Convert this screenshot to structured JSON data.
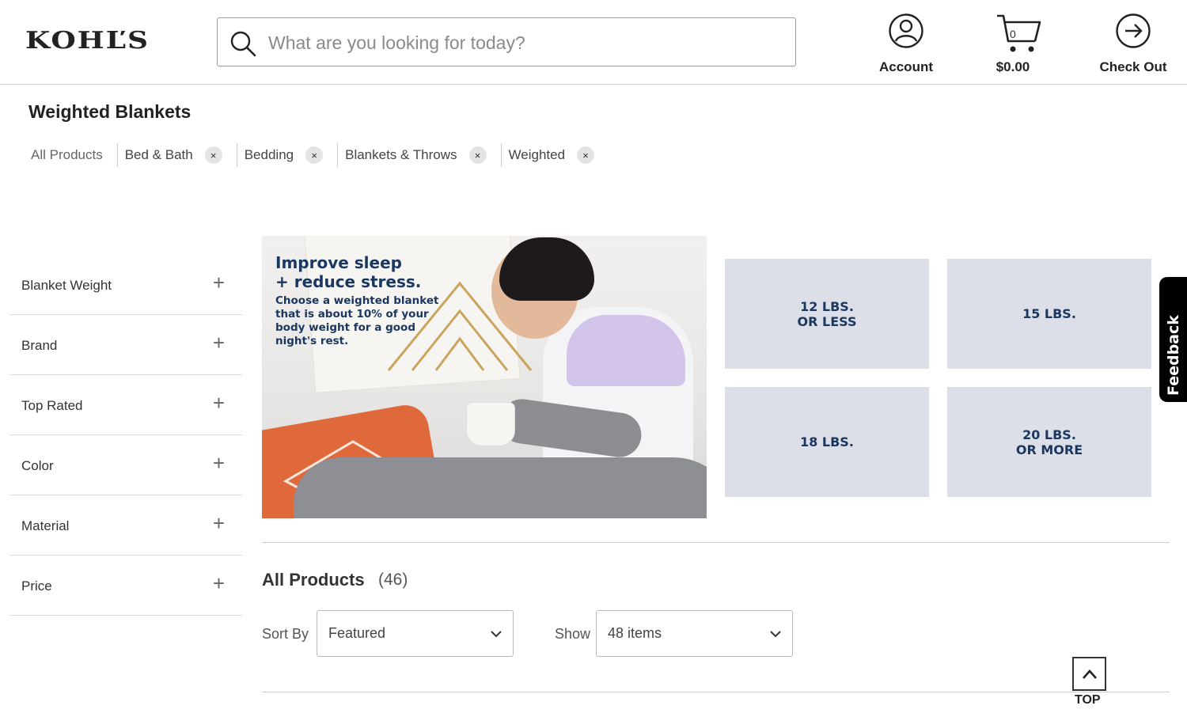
{
  "brand": {
    "logo_text": "KOHĽS"
  },
  "search": {
    "placeholder": "What are you looking for today?"
  },
  "header": {
    "account_label": "Account",
    "cart_count": "0",
    "cart_total": "$0.00",
    "checkout_label": "Check Out"
  },
  "page": {
    "title": "Weighted Blankets"
  },
  "breadcrumbs": [
    {
      "label": "All Products",
      "removable": false
    },
    {
      "label": "Bed & Bath",
      "removable": true
    },
    {
      "label": "Bedding",
      "removable": true
    },
    {
      "label": "Blankets & Throws",
      "removable": true
    },
    {
      "label": "Weighted",
      "removable": true
    }
  ],
  "remove_glyph": "×",
  "filters": [
    {
      "label": "Blanket Weight"
    },
    {
      "label": "Brand"
    },
    {
      "label": "Top Rated"
    },
    {
      "label": "Color"
    },
    {
      "label": "Material"
    },
    {
      "label": "Price"
    }
  ],
  "filter_expand_glyph": "+",
  "hero": {
    "headline_line1": "Improve sleep",
    "headline_line2": "+ reduce stress.",
    "body": "Choose a weighted blanket that is about 10% of your body weight for a good night's rest."
  },
  "weight_tiles": [
    {
      "label": "12 LBS.\nOR LESS"
    },
    {
      "label": "15 LBS."
    },
    {
      "label": "18 LBS."
    },
    {
      "label": "20 LBS.\nOR MORE"
    }
  ],
  "feedback": {
    "label": "Feedback"
  },
  "listing": {
    "title": "All Products",
    "count": "(46)",
    "sort_label": "Sort By",
    "sort_value": "Featured",
    "show_label": "Show",
    "show_value": "48 items"
  },
  "top_button": {
    "label": "TOP"
  },
  "colors": {
    "navy": "#19375f",
    "tile_bg": "#dcdee8",
    "chip_bg": "#e4e4e4"
  }
}
